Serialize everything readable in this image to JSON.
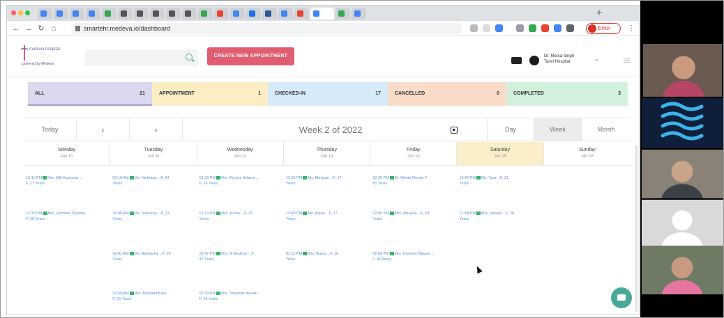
{
  "browser": {
    "tab_favicon_colors": [
      "#4285f4",
      "#4285f4",
      "#4285f4",
      "#4285f4",
      "#34a853",
      "#555555",
      "#555555",
      "#555555",
      "#555555",
      "#555555",
      "#34a853",
      "#ea4335",
      "#4285f4",
      "#1a73e8",
      "#2b5797",
      "#4285f4",
      "#ea4335",
      "#4285f4",
      "#34a853",
      "#4285f4"
    ],
    "url": "smartehr.medeva.io/dashboard",
    "profile_status": "Error"
  },
  "app": {
    "logo_name": "medeva hospital",
    "logo_sub": "powered by Medeva",
    "create_button": "CREATE NEW APPOINTMENT",
    "user_name": "Dr. Meeta Singh",
    "user_org": "Tanvi Hospital",
    "accent": "#e05d72",
    "teal": "#5fb4a2"
  },
  "status_bar": [
    {
      "label": "ALL",
      "count": "21",
      "color": "#dcd8ee"
    },
    {
      "label": "APPOINTMENT",
      "count": "1",
      "color": "#fbeec4"
    },
    {
      "label": "CHECKED-IN",
      "count": "17",
      "color": "#d6eaf7"
    },
    {
      "label": "CANCELLED",
      "count": "0",
      "color": "#f8dcc9"
    },
    {
      "label": "COMPLETED",
      "count": "3",
      "color": "#d3f0dc"
    }
  ],
  "calendar": {
    "today_label": "Today",
    "prev_label": "‹",
    "next_label": "›",
    "week_title": "Week 2 of 2022",
    "views": [
      "Day",
      "Week",
      "Month"
    ],
    "days": [
      {
        "name": "Monday",
        "date": "Jan 10"
      },
      {
        "name": "Tuesday",
        "date": "Jan 11"
      },
      {
        "name": "Wednesday",
        "date": "Jan 12"
      },
      {
        "name": "Thursday",
        "date": "Jan 13"
      },
      {
        "name": "Friday",
        "date": "Jan 14"
      },
      {
        "name": "Saturday",
        "date": "Jan 15"
      },
      {
        "name": "Sunday",
        "date": "Jan 16"
      }
    ],
    "appointments": [
      {
        "day": 0,
        "row": 0,
        "time": "12:11 PM",
        "name": "Mrs. Mili Kaseena ...",
        "meta": "F, 27 Years"
      },
      {
        "day": 1,
        "row": 0,
        "time": "09:19 AM",
        "name": "Ms. Nishtasa ...F, 34",
        "meta": "Years"
      },
      {
        "day": 2,
        "row": 0,
        "time": "01:09 PM",
        "name": "Mrs. Aruhya Srilana ...",
        "meta": "F, 28 Years"
      },
      {
        "day": 3,
        "row": 0,
        "time": "12:26 PM",
        "name": "Ms. Maryam ...F, 17",
        "meta": "Years"
      },
      {
        "day": 4,
        "row": 0,
        "time": "12:39 PM",
        "name": "Dr. Meeta Meeta, F",
        "meta": "65 Years"
      },
      {
        "day": 5,
        "row": 0,
        "time": "12:47 PM",
        "name": "Ms. Tara ...F, 21",
        "meta": "Years"
      },
      {
        "day": 0,
        "row": 1,
        "time": "12:30 PM",
        "name": "Mrs. Parveen Sharma ...",
        "meta": "F, 28 Years"
      },
      {
        "day": 1,
        "row": 1,
        "time": "10:08 AM",
        "name": "Ms. Sukeena ...F, 23",
        "meta": "Years"
      },
      {
        "day": 2,
        "row": 1,
        "time": "01:13 PM",
        "name": "Mrs. Ruma ...F, 31",
        "meta": "Years"
      },
      {
        "day": 3,
        "row": 1,
        "time": "12:40 PM",
        "name": "Ms. Anjua ...F, 17",
        "meta": "Years"
      },
      {
        "day": 4,
        "row": 1,
        "time": "02:00 PM",
        "name": "Mrs. Manjula ...F, 53",
        "meta": "Years"
      },
      {
        "day": 5,
        "row": 1,
        "time": "12:58 PM",
        "name": "Mrs. Vanani ...F, 28",
        "meta": "Years"
      },
      {
        "day": 1,
        "row": 2,
        "time": "10:41 AM",
        "name": "Ms. Abhilasha ...F, 24",
        "meta": "Years"
      },
      {
        "day": 2,
        "row": 2,
        "time": "01:47 PM",
        "name": "Mrs. S Madhuri ...F,",
        "meta": "47 Years"
      },
      {
        "day": 3,
        "row": 2,
        "time": "01:11 PM",
        "name": "Mrs. Ruma ...F, 31",
        "meta": "Years"
      },
      {
        "day": 4,
        "row": 2,
        "time": "02:09 PM",
        "name": "Mrs. Parveen Begum ...",
        "meta": "F, 40 Years"
      },
      {
        "day": 1,
        "row": 3,
        "time": "10:59 AM",
        "name": "Mrs. Ramjeet Kaur ...",
        "meta": "F, 25 Years"
      },
      {
        "day": 2,
        "row": 3,
        "time": "02:29 PM",
        "name": "Mrs. Tahmeen Ansari ...",
        "meta": "F, 29 Years"
      }
    ]
  },
  "video_tiles": [
    {
      "who": "participant-1",
      "bg": "#6b5a50",
      "face": "#c99a7e",
      "shirt": "#b84466"
    },
    {
      "who": "participant-2-logo",
      "bg": "#0f1f3a",
      "face": "#3ab4e8",
      "shirt": "#3ab4e8"
    },
    {
      "who": "participant-3",
      "bg": "#8a8276",
      "face": "#c8a488",
      "shirt": "#3b3f46"
    },
    {
      "who": "participant-4-placeholder",
      "bg": "#d9d9d9",
      "face": "#ffffff",
      "shirt": "#ffffff"
    },
    {
      "who": "participant-5",
      "bg": "#6f7a64",
      "face": "#c89a80",
      "shirt": "#e676a0"
    }
  ]
}
